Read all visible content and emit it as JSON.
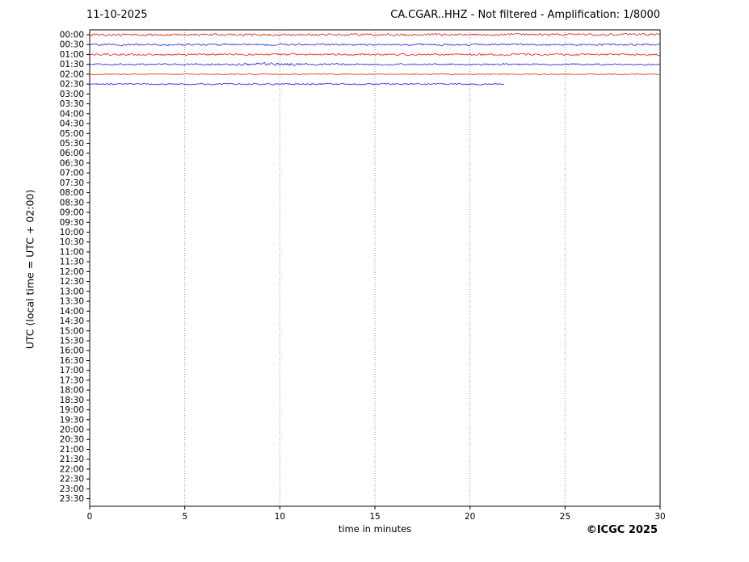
{
  "page": {
    "date_title": "11-10-2025",
    "station_title": "CA.CGAR..HHZ - Not filtered - Amplification: 1/8000",
    "credit": "©ICGC 2025"
  },
  "chart_data": {
    "type": "line",
    "subtype": "helicorder-dayplot",
    "title_left": "11-10-2025",
    "title_right": "CA.CGAR..HHZ - Not filtered - Amplification: 1/8000",
    "xlabel": "time in minutes",
    "ylabel": "UTC (local time = UTC + 02:00)",
    "xlim": [
      0,
      30
    ],
    "xticks": [
      0,
      5,
      10,
      15,
      20,
      25,
      30
    ],
    "grid": "vertical-dotted",
    "grid_color": "#8a8a8a",
    "axis_color": "#000000",
    "row_interval_minutes": 30,
    "ytick_labels": [
      "00:00",
      "00:30",
      "01:00",
      "01:30",
      "02:00",
      "02:30",
      "03:00",
      "03:30",
      "04:00",
      "04:30",
      "05:00",
      "05:30",
      "06:00",
      "06:30",
      "07:00",
      "07:30",
      "08:00",
      "08:30",
      "09:00",
      "09:30",
      "10:00",
      "10:30",
      "11:00",
      "11:30",
      "12:00",
      "12:30",
      "13:00",
      "13:30",
      "14:00",
      "14:30",
      "15:00",
      "15:30",
      "16:00",
      "16:30",
      "17:00",
      "17:30",
      "18:00",
      "18:30",
      "19:00",
      "19:30",
      "20:00",
      "20:30",
      "21:00",
      "21:30",
      "22:00",
      "22:30",
      "23:00",
      "23:30"
    ],
    "trace_colors": {
      "even_row": "#e62420",
      "odd_row": "#2428e0"
    },
    "traces": [
      {
        "time": "00:00",
        "color": "#e62420",
        "start_min": 0,
        "end_min": 30,
        "amplitude": 1.3
      },
      {
        "time": "00:30",
        "color": "#2428e0",
        "start_min": 0,
        "end_min": 30,
        "amplitude": 1.1
      },
      {
        "time": "01:00",
        "color": "#e62420",
        "start_min": 0,
        "end_min": 30,
        "amplitude": 1.1
      },
      {
        "time": "01:30",
        "color": "#2428e0",
        "start_min": 0,
        "end_min": 30,
        "amplitude": 0.9,
        "bump_min": 9.6,
        "bump_scale": 2.0,
        "bump_width_min": 1.6
      },
      {
        "time": "02:00",
        "color": "#e62420",
        "start_min": 0,
        "end_min": 30,
        "amplitude": 0.65
      },
      {
        "time": "02:30",
        "color": "#2428e0",
        "start_min": 0,
        "end_min": 21.8,
        "amplitude": 0.9
      }
    ],
    "credit": "©ICGC 2025"
  }
}
